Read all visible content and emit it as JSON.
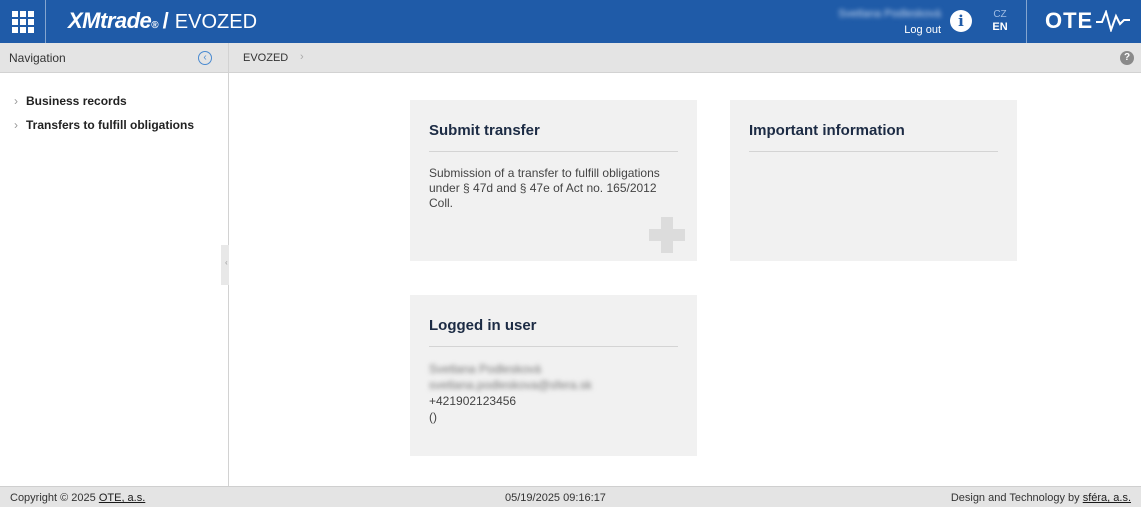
{
  "header": {
    "brand": "XMtrade",
    "brand_reg": "®",
    "separator": "/",
    "app_name": "EVOZED",
    "user_name": "Svetlana Podlesková",
    "logout_label": "Log out",
    "info_label": "i",
    "lang_cz": "CZ",
    "lang_en": "EN",
    "ote_text": "OTE",
    "colors": {
      "bar": "#1f5ba8",
      "text": "#ffffff"
    }
  },
  "navigation": {
    "title": "Navigation",
    "collapse_icon": "chevron-left-circle-icon",
    "items": [
      {
        "label": "Business records"
      },
      {
        "label": "Transfers to fulfill obligations"
      }
    ]
  },
  "breadcrumb": {
    "items": [
      {
        "label": "EVOZED"
      }
    ],
    "separator": "›",
    "help_label": "?"
  },
  "cards": {
    "submit_transfer": {
      "title": "Submit transfer",
      "text": "Submission of a transfer to fulfill obligations under § 47d and § 47e of Act no. 165/2012 Coll.",
      "icon": "plus-icon"
    },
    "important_info": {
      "title": "Important information"
    },
    "logged_user": {
      "title": "Logged in user",
      "name": "Svetlana Podlesková",
      "email": "svetlana.podleskova@sfera.sk",
      "phone": "+421902123456",
      "extra": "()"
    }
  },
  "footer": {
    "copyright_prefix": "Copyright © 2025 ",
    "copyright_link": "OTE, a.s.",
    "datetime": "05/19/2025 09:16:17",
    "design_prefix": "Design and Technology by ",
    "design_link": "sféra, a.s."
  }
}
